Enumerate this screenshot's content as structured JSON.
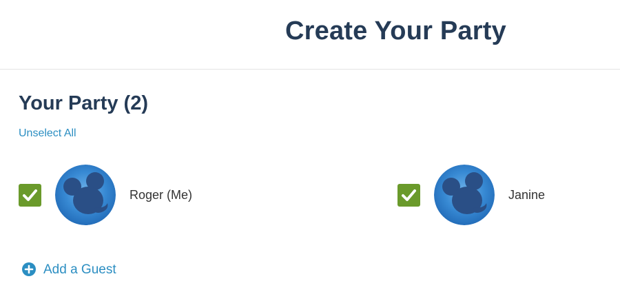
{
  "header": {
    "title": "Create Your Party"
  },
  "party": {
    "heading": "Your Party (2)",
    "unselect_all": "Unselect All",
    "members": [
      {
        "name": "Roger (Me)",
        "selected": true,
        "avatar": "mickey-silhouette-avatar"
      },
      {
        "name": "Janine",
        "selected": true,
        "avatar": "mickey-silhouette-avatar"
      }
    ],
    "add_guest": "Add a Guest"
  },
  "colors": {
    "title": "#253b56",
    "link": "#2b8ec2",
    "checkbox": "#6a9a2b",
    "avatar_blue": "#2c7fc4",
    "avatar_silhouette": "#2a4f86"
  },
  "icons": {
    "check": "checkmark-icon",
    "add": "plus-circle-icon"
  }
}
